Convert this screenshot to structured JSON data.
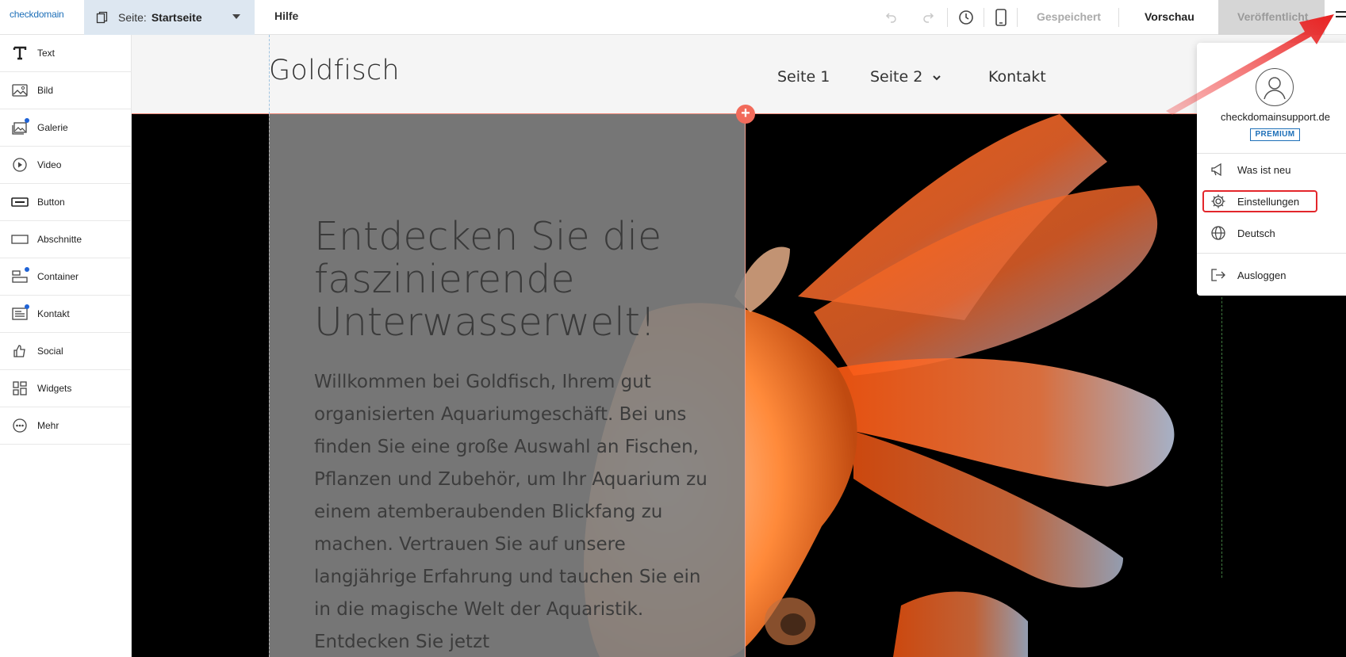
{
  "topbar": {
    "logo": "checkdomain",
    "page_label": "Seite:",
    "page_name": "Startseite",
    "help": "Hilfe",
    "saved": "Gespeichert",
    "preview": "Vorschau",
    "publish": "Veröffentlicht"
  },
  "sidebar": {
    "items": [
      {
        "label": "Text",
        "icon": "text-icon"
      },
      {
        "label": "Bild",
        "icon": "image-icon"
      },
      {
        "label": "Galerie",
        "icon": "gallery-icon"
      },
      {
        "label": "Video",
        "icon": "video-icon"
      },
      {
        "label": "Button",
        "icon": "button-icon"
      },
      {
        "label": "Abschnitte",
        "icon": "section-icon"
      },
      {
        "label": "Container",
        "icon": "container-icon"
      },
      {
        "label": "Kontakt",
        "icon": "contact-icon"
      },
      {
        "label": "Social",
        "icon": "thumbs-up-icon"
      },
      {
        "label": "Widgets",
        "icon": "widgets-icon"
      },
      {
        "label": "Mehr",
        "icon": "more-icon"
      }
    ]
  },
  "site": {
    "logo": "Goldfisch",
    "nav": [
      "Seite 1",
      "Seite 2",
      "Kontakt"
    ],
    "hero_title": "Entdecken Sie die faszinierende Unterwasserwelt!",
    "hero_text": "Willkommen bei Goldfisch, Ihrem gut organisierten Aquariumgeschäft. Bei uns finden Sie eine große Auswahl an Fischen, Pflanzen und Zubehör, um Ihr Aquarium zu einem atemberaubenden Blickfang zu machen. Vertrauen Sie auf unsere langjährige Erfahrung und tauchen Sie ein in die magische Welt der Aquaristik. Entdecken Sie jetzt"
  },
  "account_menu": {
    "email": "checkdomainsupport.de",
    "badge": "PREMIUM",
    "items": [
      {
        "label": "Was ist neu",
        "icon": "megaphone-icon"
      },
      {
        "label": "Einstellungen",
        "icon": "gear-icon"
      },
      {
        "label": "Deutsch",
        "icon": "globe-icon"
      },
      {
        "label": "Ausloggen",
        "icon": "logout-icon"
      }
    ]
  },
  "colors": {
    "accent": "#1d6fb8",
    "highlight": "#e3262b",
    "add_button": "#f26b5b"
  }
}
